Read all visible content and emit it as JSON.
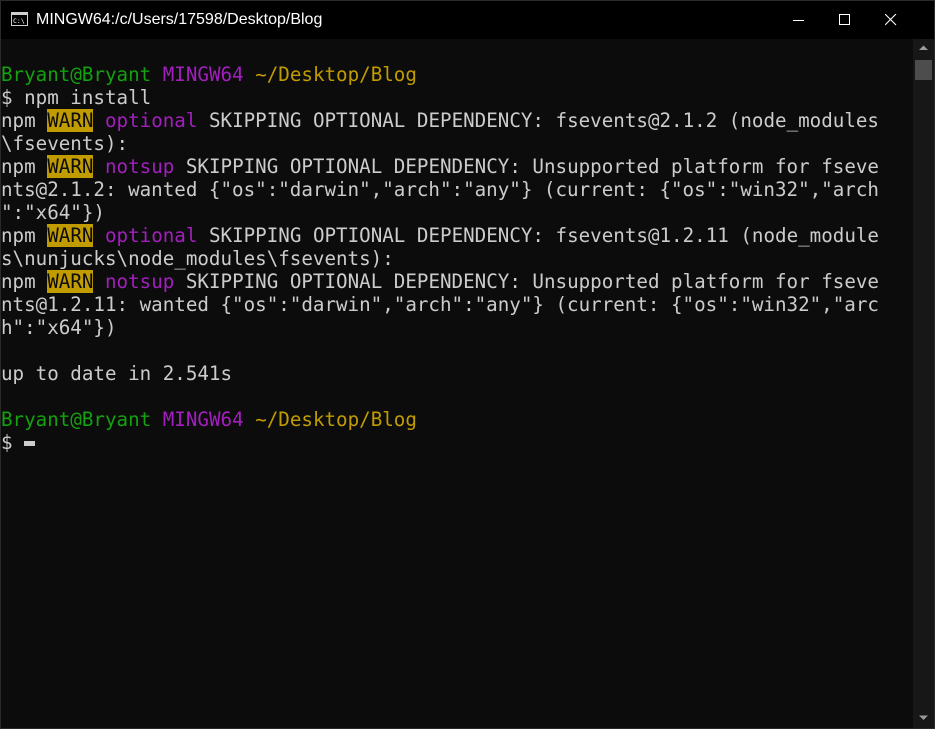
{
  "window": {
    "title": "MINGW64:/c/Users/17598/Desktop/Blog",
    "app_icon": "console-icon"
  },
  "colors": {
    "background": "#0c0c0c",
    "foreground": "#cccccc",
    "prompt_user": "#13a10e",
    "prompt_host": "#a21fbd",
    "prompt_path": "#c19c00",
    "warn_bg": "#c19c00"
  },
  "terminal": {
    "prompt1": {
      "user": "Bryant@Bryant",
      "host": "MINGW64",
      "path": "~/Desktop/Blog"
    },
    "command": "$ npm install",
    "lines": [
      {
        "prefix": "npm ",
        "badge": "WARN",
        "tag": "optional",
        "text": " SKIPPING OPTIONAL DEPENDENCY: fsevents@2.1.2 (node_modules"
      },
      {
        "text": "\\fsevents):"
      },
      {
        "prefix": "npm ",
        "badge": "WARN",
        "tag": "notsup",
        "text": " SKIPPING OPTIONAL DEPENDENCY: Unsupported platform for fseve"
      },
      {
        "text": "nts@2.1.2: wanted {\"os\":\"darwin\",\"arch\":\"any\"} (current: {\"os\":\"win32\",\"arch"
      },
      {
        "text": "\":\"x64\"})"
      },
      {
        "prefix": "npm ",
        "badge": "WARN",
        "tag": "optional",
        "text": " SKIPPING OPTIONAL DEPENDENCY: fsevents@1.2.11 (node_module"
      },
      {
        "text": "s\\nunjucks\\node_modules\\fsevents):"
      },
      {
        "prefix": "npm ",
        "badge": "WARN",
        "tag": "notsup",
        "text": " SKIPPING OPTIONAL DEPENDENCY: Unsupported platform for fseve"
      },
      {
        "text": "nts@1.2.11: wanted {\"os\":\"darwin\",\"arch\":\"any\"} (current: {\"os\":\"win32\",\"arc"
      },
      {
        "text": "h\":\"x64\"})"
      }
    ],
    "result": "up to date in 2.541s",
    "prompt2": {
      "user": "Bryant@Bryant",
      "host": "MINGW64",
      "path": "~/Desktop/Blog"
    },
    "input_prompt": "$ "
  }
}
